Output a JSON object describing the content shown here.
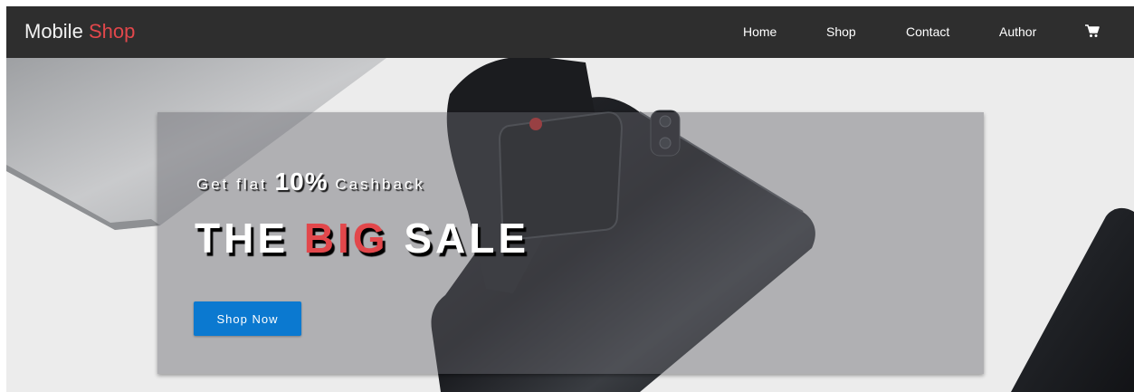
{
  "navbar": {
    "brand_primary": "Mobile",
    "brand_accent": "Shop",
    "links": [
      {
        "label": "Home"
      },
      {
        "label": "Shop"
      },
      {
        "label": "Contact"
      },
      {
        "label": "Author"
      }
    ],
    "cart_icon": "shopping-cart-icon"
  },
  "hero": {
    "tagline_prefix": "Get flat",
    "tagline_highlight": "10%",
    "tagline_suffix": "Cashback",
    "headline_part1": "THE",
    "headline_highlight": "BIG",
    "headline_part2": "SALE",
    "cta_label": "Shop Now"
  },
  "colors": {
    "navbar_bg": "#2e2e2e",
    "accent_red": "#e2474b",
    "cta_blue": "#0b79d0"
  }
}
